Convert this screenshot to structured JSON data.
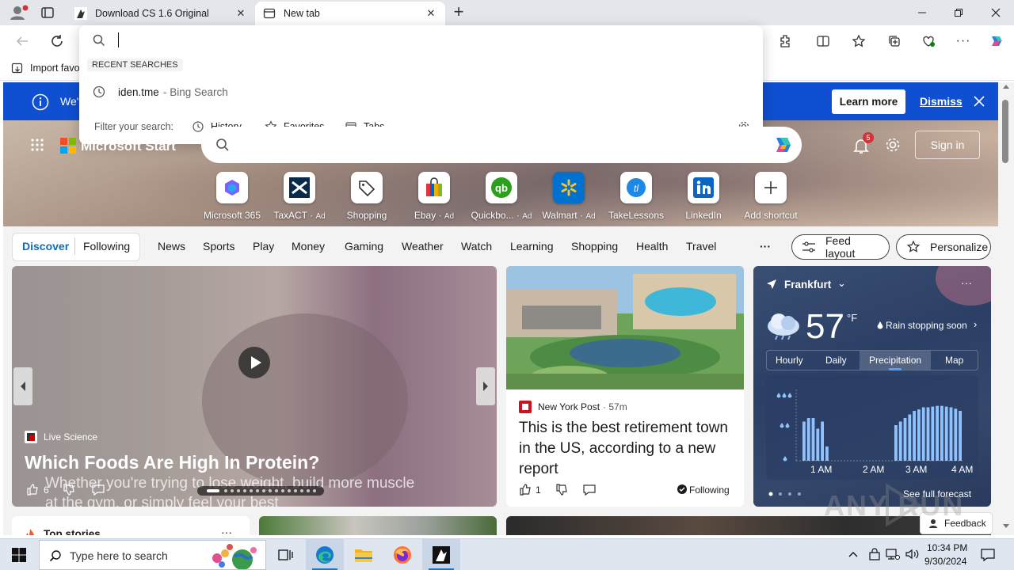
{
  "tabs": [
    {
      "title": "Download CS 1.6 Original"
    },
    {
      "title": "New tab"
    }
  ],
  "favorites_bar": {
    "import_label": "Import favo"
  },
  "omnibox": {
    "value": "",
    "section_title": "RECENT SEARCHES",
    "recent": [
      {
        "query": "iden.tme",
        "source": " - Bing Search"
      }
    ],
    "filter_label": "Filter your search:",
    "filters": [
      "History",
      "Favorites",
      "Tabs"
    ]
  },
  "banner": {
    "text": "We'",
    "learn_more": "Learn more",
    "dismiss": "Dismiss"
  },
  "header": {
    "brand": "Microsoft Start",
    "notification_count": "5",
    "sign_in": "Sign in"
  },
  "shortcuts": [
    {
      "label": "Microsoft 365",
      "ad": ""
    },
    {
      "label": "TaxACT",
      "ad": "Ad"
    },
    {
      "label": "Shopping",
      "ad": ""
    },
    {
      "label": "Ebay",
      "ad": "Ad"
    },
    {
      "label": "Quickbo...",
      "ad": "Ad"
    },
    {
      "label": "Walmart",
      "ad": "Ad"
    },
    {
      "label": "TakeLessons",
      "ad": ""
    },
    {
      "label": "LinkedIn",
      "ad": ""
    },
    {
      "label": "Add shortcut",
      "ad": ""
    }
  ],
  "nav": {
    "discover": "Discover",
    "following": "Following",
    "items": [
      "News",
      "Sports",
      "Play",
      "Money",
      "Gaming",
      "Weather",
      "Watch",
      "Learning",
      "Shopping",
      "Health",
      "Travel"
    ],
    "more": "···",
    "feed_layout": "Feed layout",
    "personalize": "Personalize"
  },
  "main_card": {
    "source": "Live Science",
    "title": "Which Foods Are High In Protein?",
    "subtitle": "Whether you're trying to lose weight, build more muscle at the gym, or simply feel your best",
    "likes": "6"
  },
  "news_card": {
    "source": "New York Post",
    "age": "57m",
    "title": "This is the best retirement town in the US, according to a new report",
    "likes": "1",
    "following": "Following"
  },
  "weather": {
    "city": "Frankfurt",
    "temp": "57",
    "unit": "°F",
    "summary": "Rain stopping soon",
    "tabs": [
      "Hourly",
      "Daily",
      "Precipitation",
      "Map"
    ],
    "active_tab": "Precipitation",
    "x_labels": [
      "1 AM",
      "2 AM",
      "3 AM",
      "4 AM"
    ],
    "see_full": "See full forecast",
    "precip_bars": [
      0.55,
      0.6,
      0.6,
      0.45,
      0.55,
      0.2,
      0.0,
      0.0,
      0.0,
      0.0,
      0.0,
      0.0,
      0.0,
      0.0,
      0.0,
      0.0,
      0.0,
      0.0,
      0.0,
      0.0,
      0.5,
      0.55,
      0.6,
      0.65,
      0.7,
      0.72,
      0.75,
      0.75,
      0.76,
      0.77,
      0.77,
      0.76,
      0.75,
      0.73,
      0.7
    ]
  },
  "bottom": {
    "top_stories": "Top stories",
    "feedback": "Feedback"
  },
  "taskbar": {
    "search_placeholder": "Type here to search",
    "time": "10:34 PM",
    "date": "9/30/2024"
  },
  "watermark": "ANY RUN"
}
